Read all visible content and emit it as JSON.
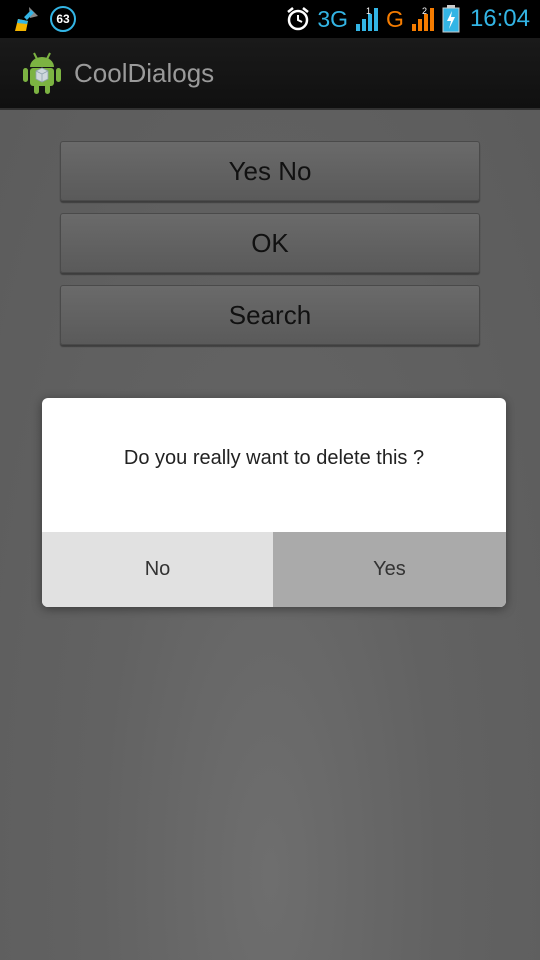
{
  "status_bar": {
    "notification_count": "63",
    "network_1": "3G",
    "sim_1": "1",
    "network_2": "G",
    "sim_2": "2",
    "time": "16:04"
  },
  "action_bar": {
    "title": "CoolDialogs"
  },
  "main": {
    "buttons": [
      {
        "label": "Yes No"
      },
      {
        "label": "OK"
      },
      {
        "label": "Search"
      }
    ]
  },
  "dialog": {
    "message": "Do you really want to delete this ?",
    "negative_label": "No",
    "positive_label": "Yes"
  },
  "colors": {
    "status_accent": "#33b5e5",
    "network_g": "#f57c00",
    "dialog_positive_bg": "#aaaaaa",
    "dialog_negative_bg": "#e1e1e1"
  }
}
